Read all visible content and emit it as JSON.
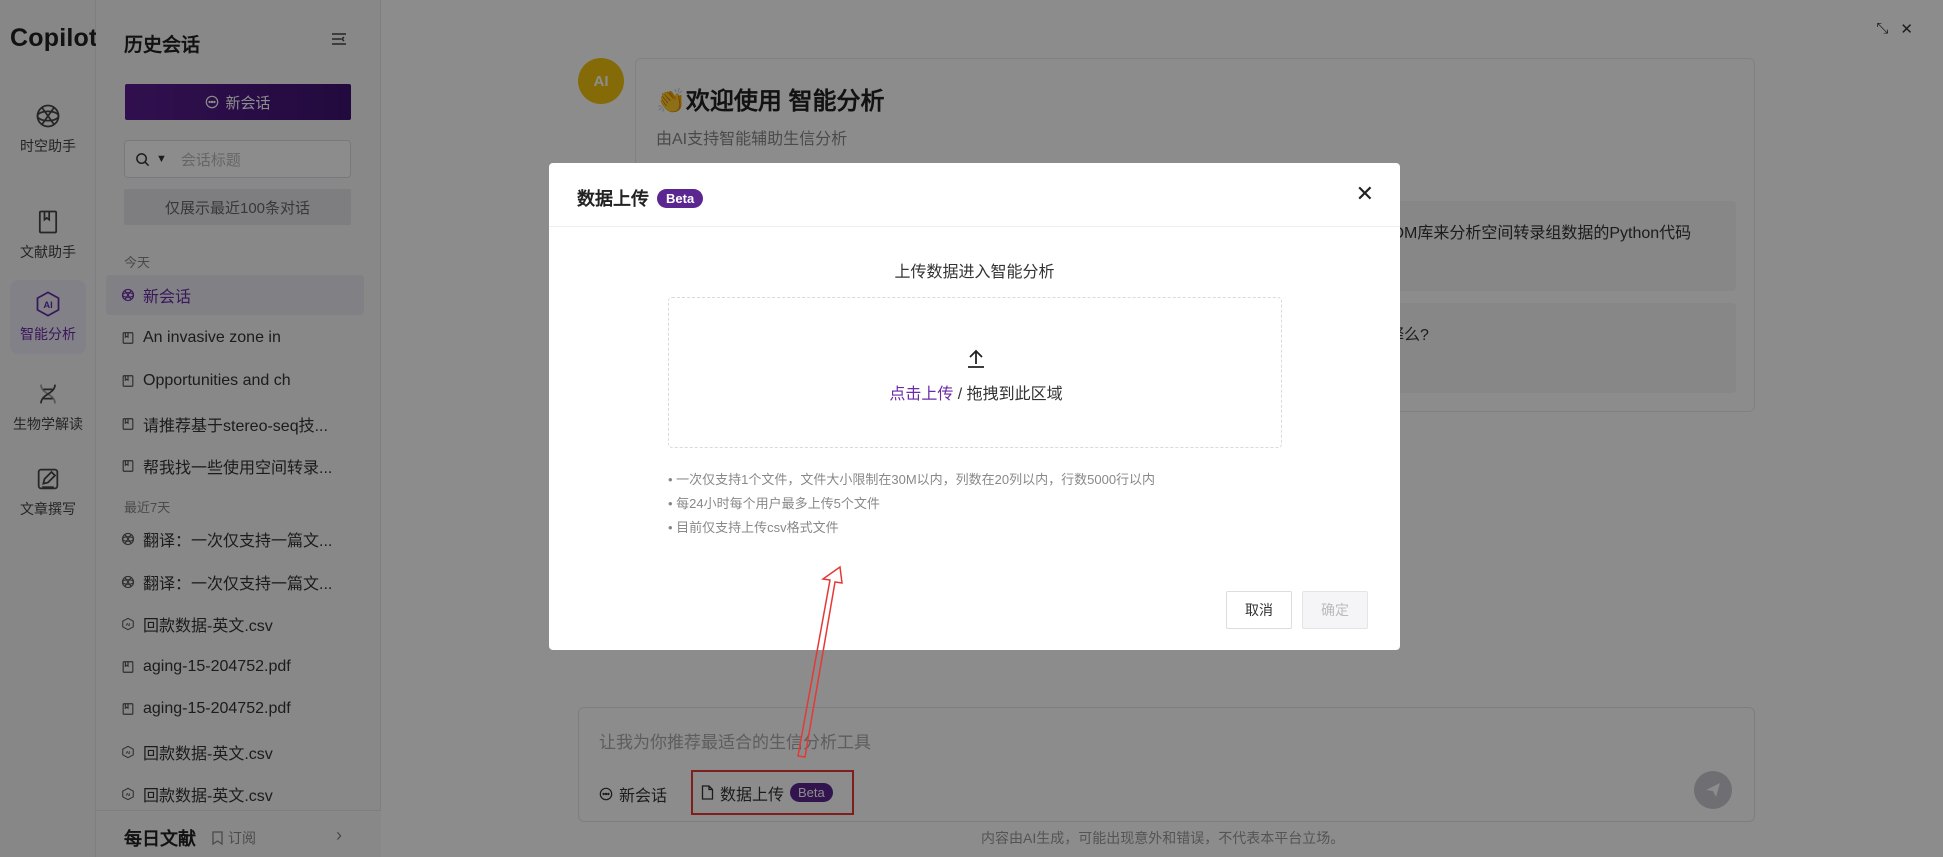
{
  "brand": "Copilot",
  "rail": [
    {
      "label": "时空助手",
      "icon": "globe-icon"
    },
    {
      "label": "文献助手",
      "icon": "book-icon"
    },
    {
      "label": "智能分析",
      "icon": "ai-icon",
      "active": true
    },
    {
      "label": "生物学解读",
      "icon": "dna-icon"
    },
    {
      "label": "文章撰写",
      "icon": "edit-icon"
    }
  ],
  "sidebar": {
    "title": "历史会话",
    "new_chat": "新会话",
    "search_placeholder": "会话标题",
    "only_recent": "仅展示最近100条对话",
    "today_label": "今天",
    "recent_label": "最近7天",
    "today": [
      {
        "label": "新会话",
        "active": true
      },
      {
        "label": "An invasive zone in"
      },
      {
        "label": "Opportunities and ch"
      },
      {
        "label": "请推荐基于stereo-seq技..."
      },
      {
        "label": "帮我找一些使用空间转录..."
      }
    ],
    "recent": [
      {
        "label": "翻译：一次仅支持一篇文..."
      },
      {
        "label": "翻译：一次仅支持一篇文..."
      },
      {
        "label": "回款数据-英文.csv"
      },
      {
        "label": "aging-15-204752.pdf"
      },
      {
        "label": "aging-15-204752.pdf"
      },
      {
        "label": "回款数据-英文.csv"
      },
      {
        "label": "回款数据-英文.csv"
      }
    ],
    "daily": "每日文献",
    "subscribe": "订阅"
  },
  "main": {
    "avatar": "AI",
    "welcome_title": "👏欢迎使用 智能分析",
    "welcome_sub": "由AI支持智能辅助生信分析",
    "suggestion_1": "IDM库来分析空间转录组数据的Python代码",
    "suggestion_2": "释么?",
    "composer_placeholder": "让我为你推荐最适合的生信分析工具",
    "composer_new": "新会话",
    "composer_upload": "数据上传",
    "beta": "Beta",
    "footer_note": "内容由AI生成，可能出现意外和错误，不代表本平台立场。"
  },
  "modal": {
    "title": "数据上传",
    "beta": "Beta",
    "subtitle": "上传数据进入智能分析",
    "click_upload": "点击上传",
    "drag_text": " / 拖拽到此区域",
    "rules": [
      "• 一次仅支持1个文件，文件大小限制在30M以内，列数在20列以内，行数5000行以内",
      "• 每24小时每个用户最多上传5个文件",
      "• 目前仅支持上传csv格式文件"
    ],
    "cancel": "取消",
    "confirm": "确定"
  }
}
